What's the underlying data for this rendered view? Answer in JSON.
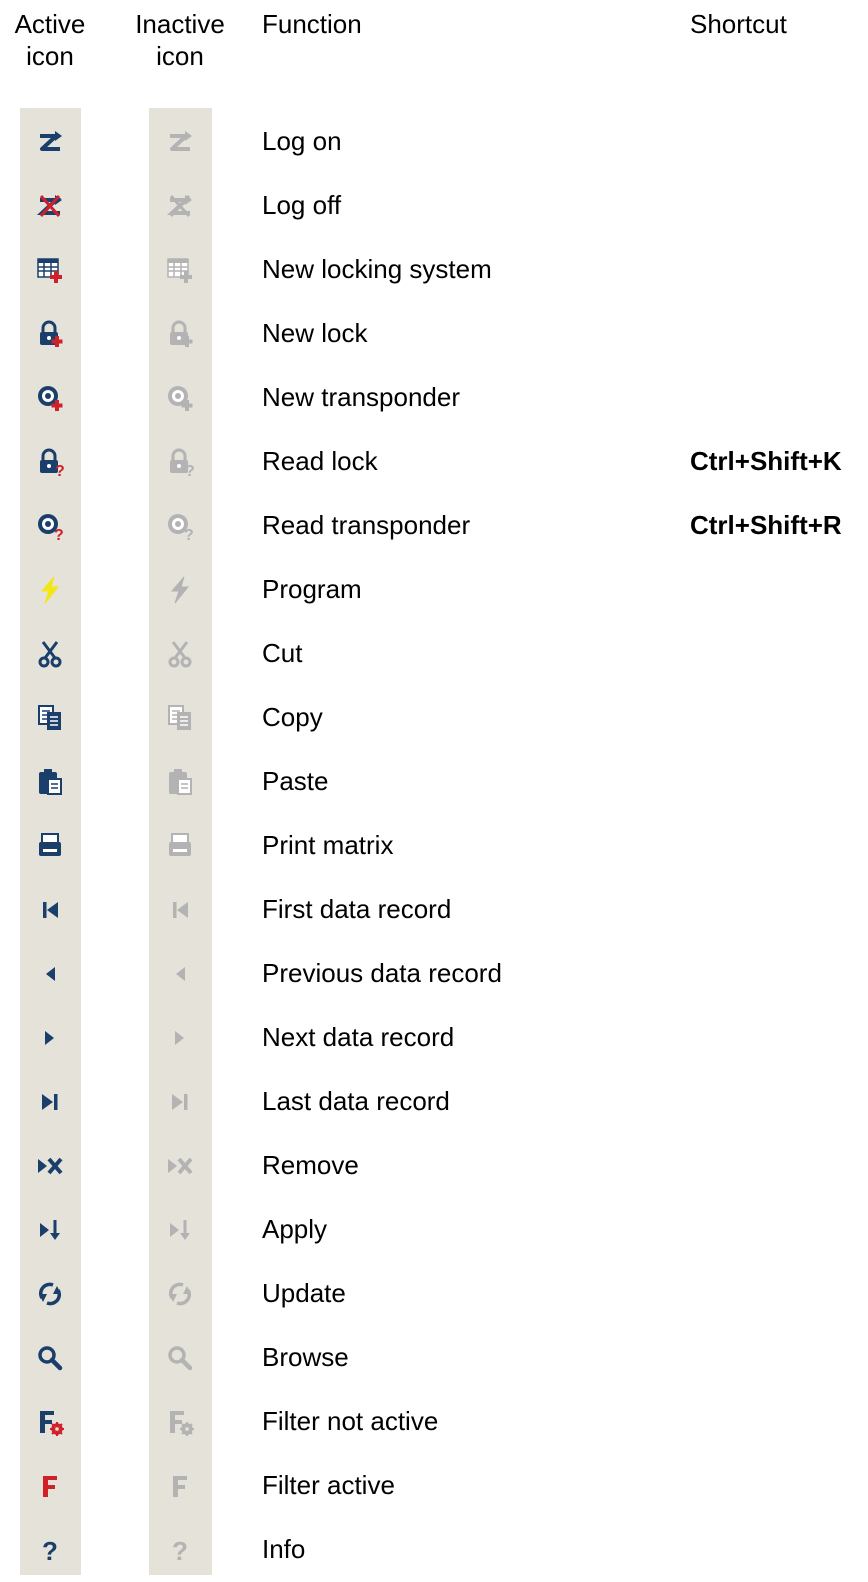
{
  "headers": {
    "active_line1": "Active",
    "active_line2": "icon",
    "inactive_line1": "Inactive",
    "inactive_line2": "icon",
    "function": "Function",
    "shortcut": "Shortcut"
  },
  "colors": {
    "active_primary": "#1a3f6b",
    "active_accent": "#d0202a",
    "active_lightning": "#f2e614",
    "inactive": "#b3b3b3",
    "strip_background": "#e5e2da"
  },
  "rows": [
    {
      "icon": "log-on-icon",
      "function": "Log on",
      "shortcut": ""
    },
    {
      "icon": "log-off-icon",
      "function": "Log off",
      "shortcut": ""
    },
    {
      "icon": "new-locking-system-icon",
      "function": "New locking system",
      "shortcut": ""
    },
    {
      "icon": "new-lock-icon",
      "function": "New lock",
      "shortcut": ""
    },
    {
      "icon": "new-transponder-icon",
      "function": "New transponder",
      "shortcut": ""
    },
    {
      "icon": "read-lock-icon",
      "function": "Read lock",
      "shortcut": "Ctrl+Shift+K"
    },
    {
      "icon": "read-transponder-icon",
      "function": "Read transponder",
      "shortcut": "Ctrl+Shift+R"
    },
    {
      "icon": "program-icon",
      "function": "Program",
      "shortcut": ""
    },
    {
      "icon": "cut-icon",
      "function": "Cut",
      "shortcut": ""
    },
    {
      "icon": "copy-icon",
      "function": "Copy",
      "shortcut": ""
    },
    {
      "icon": "paste-icon",
      "function": "Paste",
      "shortcut": ""
    },
    {
      "icon": "print-matrix-icon",
      "function": "Print matrix",
      "shortcut": ""
    },
    {
      "icon": "first-record-icon",
      "function": "First data record",
      "shortcut": ""
    },
    {
      "icon": "previous-record-icon",
      "function": "Previous data record",
      "shortcut": ""
    },
    {
      "icon": "next-record-icon",
      "function": "Next data record",
      "shortcut": ""
    },
    {
      "icon": "last-record-icon",
      "function": "Last data record",
      "shortcut": ""
    },
    {
      "icon": "remove-icon",
      "function": "Remove",
      "shortcut": ""
    },
    {
      "icon": "apply-icon",
      "function": "Apply",
      "shortcut": ""
    },
    {
      "icon": "update-icon",
      "function": "Update",
      "shortcut": ""
    },
    {
      "icon": "browse-icon",
      "function": "Browse",
      "shortcut": ""
    },
    {
      "icon": "filter-not-active-icon",
      "function": "Filter not active",
      "shortcut": ""
    },
    {
      "icon": "filter-active-icon",
      "function": "Filter active",
      "shortcut": ""
    },
    {
      "icon": "info-icon",
      "function": "Info",
      "shortcut": ""
    }
  ]
}
